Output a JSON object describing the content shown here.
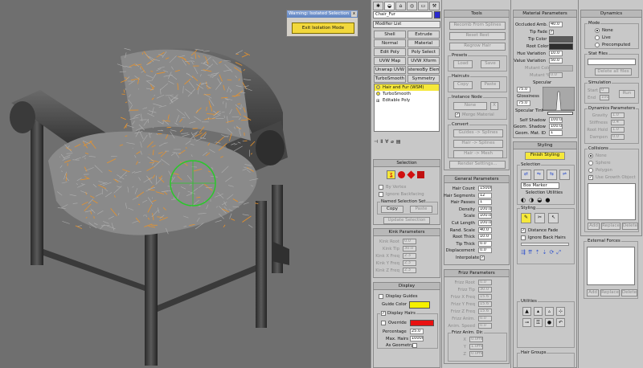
{
  "isolation": {
    "title": "Warning: Isolated Selection",
    "close": "x",
    "button": "Exit Isolation Mode"
  },
  "modify": {
    "object_name": "Chair_Fur",
    "object_color": "#2a2ad0",
    "modifier_list": "Modifier List",
    "buttons": [
      "Shell",
      "Extrude",
      "Normal",
      "Material",
      "Edit Poly",
      "Poly Select",
      "UVW Map",
      "UVW Xform",
      "Unwrap UVW",
      "stereoBy Eleme",
      "TurboSmooth",
      "Symmetry"
    ],
    "stack": [
      "Hair and Fur (WSM)",
      "TurboSmooth",
      "Editable Poly"
    ],
    "toolbar_icons": [
      "pin-icon",
      "show-end-icon",
      "make-unique-icon",
      "remove-modifier-icon",
      "configure-icon"
    ]
  },
  "selection": {
    "title": "Selection",
    "by_vertex": "By Vertex",
    "ignore_backfacing": "Ignore Backfacing",
    "named_set": "Named Selection Set",
    "copy": "Copy",
    "paste": "Paste",
    "update": "Update Selection"
  },
  "kink": {
    "title": "Kink Parameters",
    "rows": [
      {
        "label": "Kink Root",
        "value": "0.0"
      },
      {
        "label": "Kink Tip",
        "value": "30.0"
      },
      {
        "label": "Kink X Freq",
        "value": "2.3"
      },
      {
        "label": "Kink Y Freq",
        "value": "2.3"
      },
      {
        "label": "Kink Z Freq",
        "value": "2.3"
      }
    ]
  },
  "display": {
    "title": "Display",
    "display_guides": "Display Guides",
    "guide_color": "Guide Color",
    "guide_color_value": "#f5f000",
    "display_hairs": "Display Hairs",
    "override": "Override",
    "override_color": "#e81010",
    "percentage": "Percentage",
    "percentage_value": "25.0",
    "max_hairs": "Max. Hairs",
    "max_hairs_value": "10000",
    "as_geometry": "As Geometry"
  },
  "tools": {
    "title": "Tools",
    "buttons": [
      "Recomb From Splines",
      "Reset Rest",
      "Regrow Hair"
    ],
    "presets": "Presets",
    "load": "Load",
    "save": "Save",
    "haircuts": "Haircuts",
    "copy": "Copy",
    "paste": "Paste",
    "instance_node": "Instance Node",
    "none": "None",
    "x": "X",
    "merge_material": "Merge Material",
    "convert": "Convert",
    "convert_buttons": [
      "Guides -> Splines",
      "Hair -> Splines",
      "Hair -> Mesh"
    ],
    "render_settings": "Render Settings..."
  },
  "general": {
    "title": "General Parameters",
    "rows": [
      {
        "label": "Hair Count",
        "value": "15000"
      },
      {
        "label": "Hair Segments",
        "value": "12"
      },
      {
        "label": "Hair Passes",
        "value": "1"
      },
      {
        "label": "Density",
        "value": "100.0"
      },
      {
        "label": "Scale",
        "value": "100.0"
      },
      {
        "label": "Cut Length",
        "value": "100.0"
      },
      {
        "label": "Rand. Scale",
        "value": "40.0"
      },
      {
        "label": "Root Thick",
        "value": "10.0"
      },
      {
        "label": "Tip Thick",
        "value": "0.0"
      },
      {
        "label": "Displacement",
        "value": "0.0"
      }
    ],
    "interpolate": "Interpolate"
  },
  "frizz": {
    "title": "Frizz Parameters",
    "rows": [
      {
        "label": "Frizz Root",
        "value": "0.0"
      },
      {
        "label": "Frizz Tip",
        "value": "30.0"
      },
      {
        "label": "Frizz X Freq",
        "value": "15.6"
      },
      {
        "label": "Frizz Y Freq",
        "value": "15.6"
      },
      {
        "label": "Frizz Z Freq",
        "value": "15.6"
      },
      {
        "label": "Frizz Anim.",
        "value": "0.0"
      },
      {
        "label": "Anim. Speed",
        "value": "0.0"
      }
    ],
    "anim_dir": "Frizz Anim. Dir.",
    "dir_rows": [
      {
        "label": "X",
        "value": "0.0mm"
      },
      {
        "label": "Y",
        "value": "1.0mm"
      },
      {
        "label": "Z",
        "value": "0.0mm"
      }
    ]
  },
  "material": {
    "title": "Material Parameters",
    "occluded_amb": "Occluded Amb.",
    "occluded_value": "40.0",
    "tip_fade": "Tip Fade",
    "tip_color": "Tip Color",
    "root_color": "Root Color",
    "tip_color_value": "#5a5a5a",
    "root_color_value": "#2e2e2e",
    "rows": [
      {
        "label": "Hue Variation",
        "value": "10.0"
      },
      {
        "label": "Value Variation",
        "value": "50.0"
      }
    ],
    "mutant_color": "Mutant Color",
    "mutant_pct": "Mutant %",
    "mutant_value": "0.0",
    "specular": "Specular",
    "specular_value": "75.0",
    "glossiness": "Glossiness",
    "glossiness_value": "75.0",
    "specular_tint": "Specular Tint",
    "extra_rows": [
      {
        "label": "Self Shadow",
        "value": "100.0"
      },
      {
        "label": "Geom. Shadow",
        "value": "100.0"
      },
      {
        "label": "Geom. Mat. ID",
        "value": "1"
      }
    ]
  },
  "styling": {
    "title": "Styling",
    "finish": "Finish Styling",
    "selection": "Selection",
    "box_marker": "Box Marker",
    "selection_utilities": "Selection Utilities",
    "styling": "Styling",
    "distance_fade": "Distance Fade",
    "ignore_back_hairs": "Ignore Back Hairs",
    "utilities": "Utilities",
    "hair_groups": "Hair Groups"
  },
  "dynamics": {
    "title": "Dynamics",
    "mode": "Mode",
    "modes": [
      "None",
      "Live",
      "Precomputed"
    ],
    "stat_files": "Stat Files",
    "delete_all": "Delete all files",
    "simulation": "Simulation",
    "start": "Start",
    "start_value": "0",
    "end": "End",
    "end_value": "100",
    "run": "Run",
    "dyn_params": "Dynamics Parameters",
    "rows": [
      {
        "label": "Gravity",
        "value": "1.0"
      },
      {
        "label": "Stiffness",
        "value": "0.4"
      },
      {
        "label": "Root Hold",
        "value": "1.0"
      },
      {
        "label": "Dampen",
        "value": "0.0"
      }
    ],
    "collisions": "Collisions",
    "coll_modes": [
      "None",
      "Sphere",
      "Polygon"
    ],
    "use_growth": "Use Growth Object",
    "add": "Add",
    "replace": "Replace",
    "delete": "Delete",
    "external_forces": "External Forces"
  }
}
